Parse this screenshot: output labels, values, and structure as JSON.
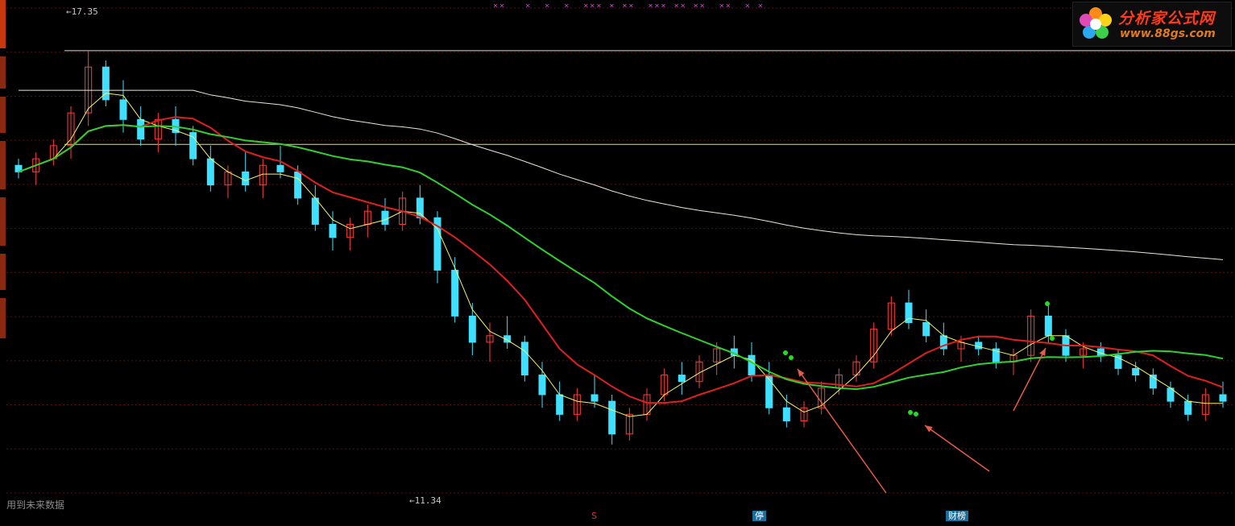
{
  "chart_data": {
    "type": "candlestick",
    "ylim": [
      10.6,
      18.0
    ],
    "annotations": {
      "high_marker": "17.35",
      "low_marker": "11.34",
      "note": "用到未来数据"
    },
    "ref_lines": [
      {
        "value": 17.35,
        "color": "#d8d8d8"
      },
      {
        "value": 15.92,
        "color": "#e8e06a"
      }
    ],
    "candles": [
      [
        15.6,
        15.7,
        15.4,
        15.5
      ],
      [
        15.5,
        15.8,
        15.3,
        15.7
      ],
      [
        15.7,
        16.0,
        15.6,
        15.9
      ],
      [
        15.9,
        16.5,
        15.7,
        16.4
      ],
      [
        16.4,
        17.35,
        16.2,
        17.1
      ],
      [
        17.1,
        17.2,
        16.5,
        16.6
      ],
      [
        16.6,
        16.9,
        16.1,
        16.3
      ],
      [
        16.3,
        16.5,
        15.9,
        16.0
      ],
      [
        16.0,
        16.4,
        15.8,
        16.3
      ],
      [
        16.3,
        16.5,
        15.9,
        16.1
      ],
      [
        16.1,
        16.2,
        15.6,
        15.7
      ],
      [
        15.7,
        15.9,
        15.2,
        15.3
      ],
      [
        15.3,
        15.6,
        15.1,
        15.5
      ],
      [
        15.5,
        15.8,
        15.2,
        15.3
      ],
      [
        15.3,
        15.7,
        15.1,
        15.6
      ],
      [
        15.6,
        15.9,
        15.4,
        15.5
      ],
      [
        15.5,
        15.6,
        15.0,
        15.1
      ],
      [
        15.1,
        15.3,
        14.6,
        14.7
      ],
      [
        14.7,
        14.9,
        14.3,
        14.5
      ],
      [
        14.5,
        14.8,
        14.3,
        14.7
      ],
      [
        14.7,
        15.0,
        14.5,
        14.9
      ],
      [
        14.9,
        15.1,
        14.6,
        14.7
      ],
      [
        14.7,
        15.2,
        14.6,
        15.1
      ],
      [
        15.1,
        15.3,
        14.7,
        14.8
      ],
      [
        14.8,
        14.9,
        13.8,
        14.0
      ],
      [
        14.0,
        14.2,
        13.2,
        13.3
      ],
      [
        13.3,
        13.5,
        12.7,
        12.9
      ],
      [
        12.9,
        13.2,
        12.6,
        13.0
      ],
      [
        13.0,
        13.3,
        12.8,
        12.9
      ],
      [
        12.9,
        13.0,
        12.3,
        12.4
      ],
      [
        12.4,
        12.6,
        11.9,
        12.1
      ],
      [
        12.1,
        12.3,
        11.7,
        11.8
      ],
      [
        11.8,
        12.2,
        11.7,
        12.1
      ],
      [
        12.1,
        12.4,
        11.9,
        12.0
      ],
      [
        12.0,
        12.1,
        11.34,
        11.5
      ],
      [
        11.5,
        11.9,
        11.4,
        11.8
      ],
      [
        11.8,
        12.2,
        11.7,
        12.1
      ],
      [
        12.1,
        12.5,
        12.0,
        12.4
      ],
      [
        12.4,
        12.6,
        12.1,
        12.3
      ],
      [
        12.3,
        12.7,
        12.2,
        12.6
      ],
      [
        12.6,
        12.9,
        12.4,
        12.8
      ],
      [
        12.8,
        13.0,
        12.5,
        12.7
      ],
      [
        12.7,
        12.9,
        12.3,
        12.4
      ],
      [
        12.4,
        12.6,
        11.8,
        11.9
      ],
      [
        11.9,
        12.1,
        11.6,
        11.7
      ],
      [
        11.7,
        12.0,
        11.6,
        11.9
      ],
      [
        11.9,
        12.3,
        11.8,
        12.2
      ],
      [
        12.2,
        12.5,
        12.1,
        12.4
      ],
      [
        12.4,
        12.7,
        12.3,
        12.6
      ],
      [
        12.6,
        13.2,
        12.5,
        13.1
      ],
      [
        13.1,
        13.6,
        13.0,
        13.5
      ],
      [
        13.5,
        13.7,
        13.1,
        13.2
      ],
      [
        13.2,
        13.4,
        12.9,
        13.0
      ],
      [
        13.0,
        13.2,
        12.7,
        12.8
      ],
      [
        12.8,
        13.0,
        12.6,
        12.9
      ],
      [
        12.9,
        13.0,
        12.7,
        12.8
      ],
      [
        12.8,
        12.9,
        12.5,
        12.6
      ],
      [
        12.6,
        12.8,
        12.4,
        12.7
      ],
      [
        12.7,
        13.4,
        12.6,
        13.3
      ],
      [
        13.3,
        13.5,
        12.9,
        13.0
      ],
      [
        13.0,
        13.1,
        12.6,
        12.7
      ],
      [
        12.7,
        12.9,
        12.5,
        12.8
      ],
      [
        12.8,
        12.9,
        12.6,
        12.7
      ],
      [
        12.7,
        12.8,
        12.4,
        12.5
      ],
      [
        12.5,
        12.6,
        12.3,
        12.4
      ],
      [
        12.4,
        12.5,
        12.1,
        12.2
      ],
      [
        12.2,
        12.3,
        11.9,
        12.0
      ],
      [
        12.0,
        12.1,
        11.7,
        11.8
      ],
      [
        11.8,
        12.2,
        11.7,
        12.1
      ],
      [
        12.1,
        12.3,
        11.9,
        12.0
      ]
    ]
  },
  "overlay": {
    "top_markers": "××   ×  ×  ×  ××× × ××  ××× ×× ××  ××  × ×",
    "badges": [
      {
        "text": "S",
        "color": "#ff2020",
        "bg": "#000"
      },
      {
        "text": "停",
        "color": "#ffffff",
        "bg": "#1a6e9a"
      },
      {
        "text": "财榜",
        "color": "#ffffff",
        "bg": "#1a6e9a"
      }
    ]
  },
  "logo": {
    "name": "分析家公式网",
    "url": "www.88gs.com"
  },
  "colors": {
    "up": "#ff3b3b",
    "down": "#3fe0ff",
    "ma_short": "#f4f46a",
    "ma_mid": "#e02020",
    "ma_long": "#30d030",
    "ma_very_long": "#e8e8d8",
    "signal_dot": "#22dd22",
    "arrow": "#e85a4a",
    "grid": "#5a1010",
    "bg": "#000000"
  }
}
